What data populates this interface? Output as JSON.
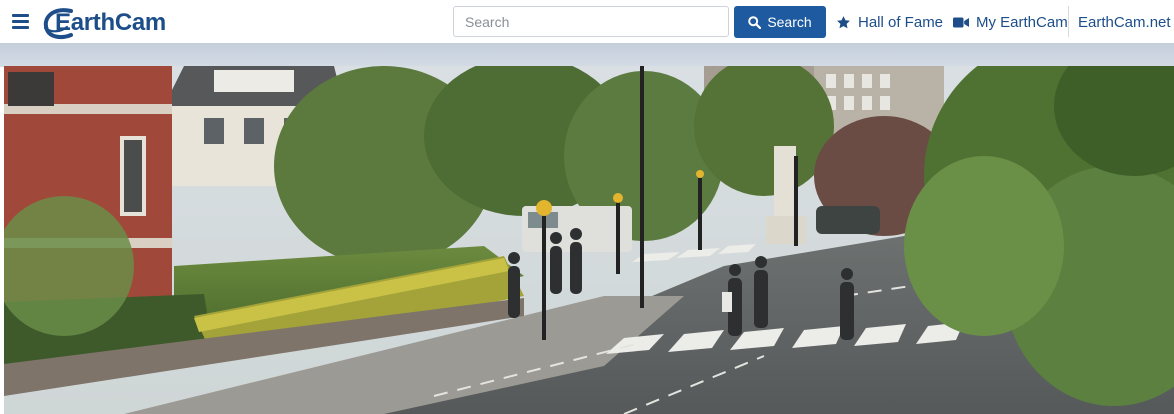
{
  "header": {
    "brand": "EarthCam",
    "search": {
      "placeholder": "Search",
      "value": ""
    },
    "search_button_label": "Search",
    "nav": [
      {
        "label": "Hall of Fame",
        "icon": "star-icon"
      },
      {
        "label": "My EarthCam",
        "icon": "video-camera-icon"
      },
      {
        "label": "EarthCam.net"
      }
    ]
  },
  "camera_feed": {
    "scene": "live webcam view of a street zebra crossing with pedestrians"
  },
  "colors": {
    "brand_blue": "#1d4e89",
    "button_blue": "#1d5aa0",
    "band": "#c8d2de"
  }
}
